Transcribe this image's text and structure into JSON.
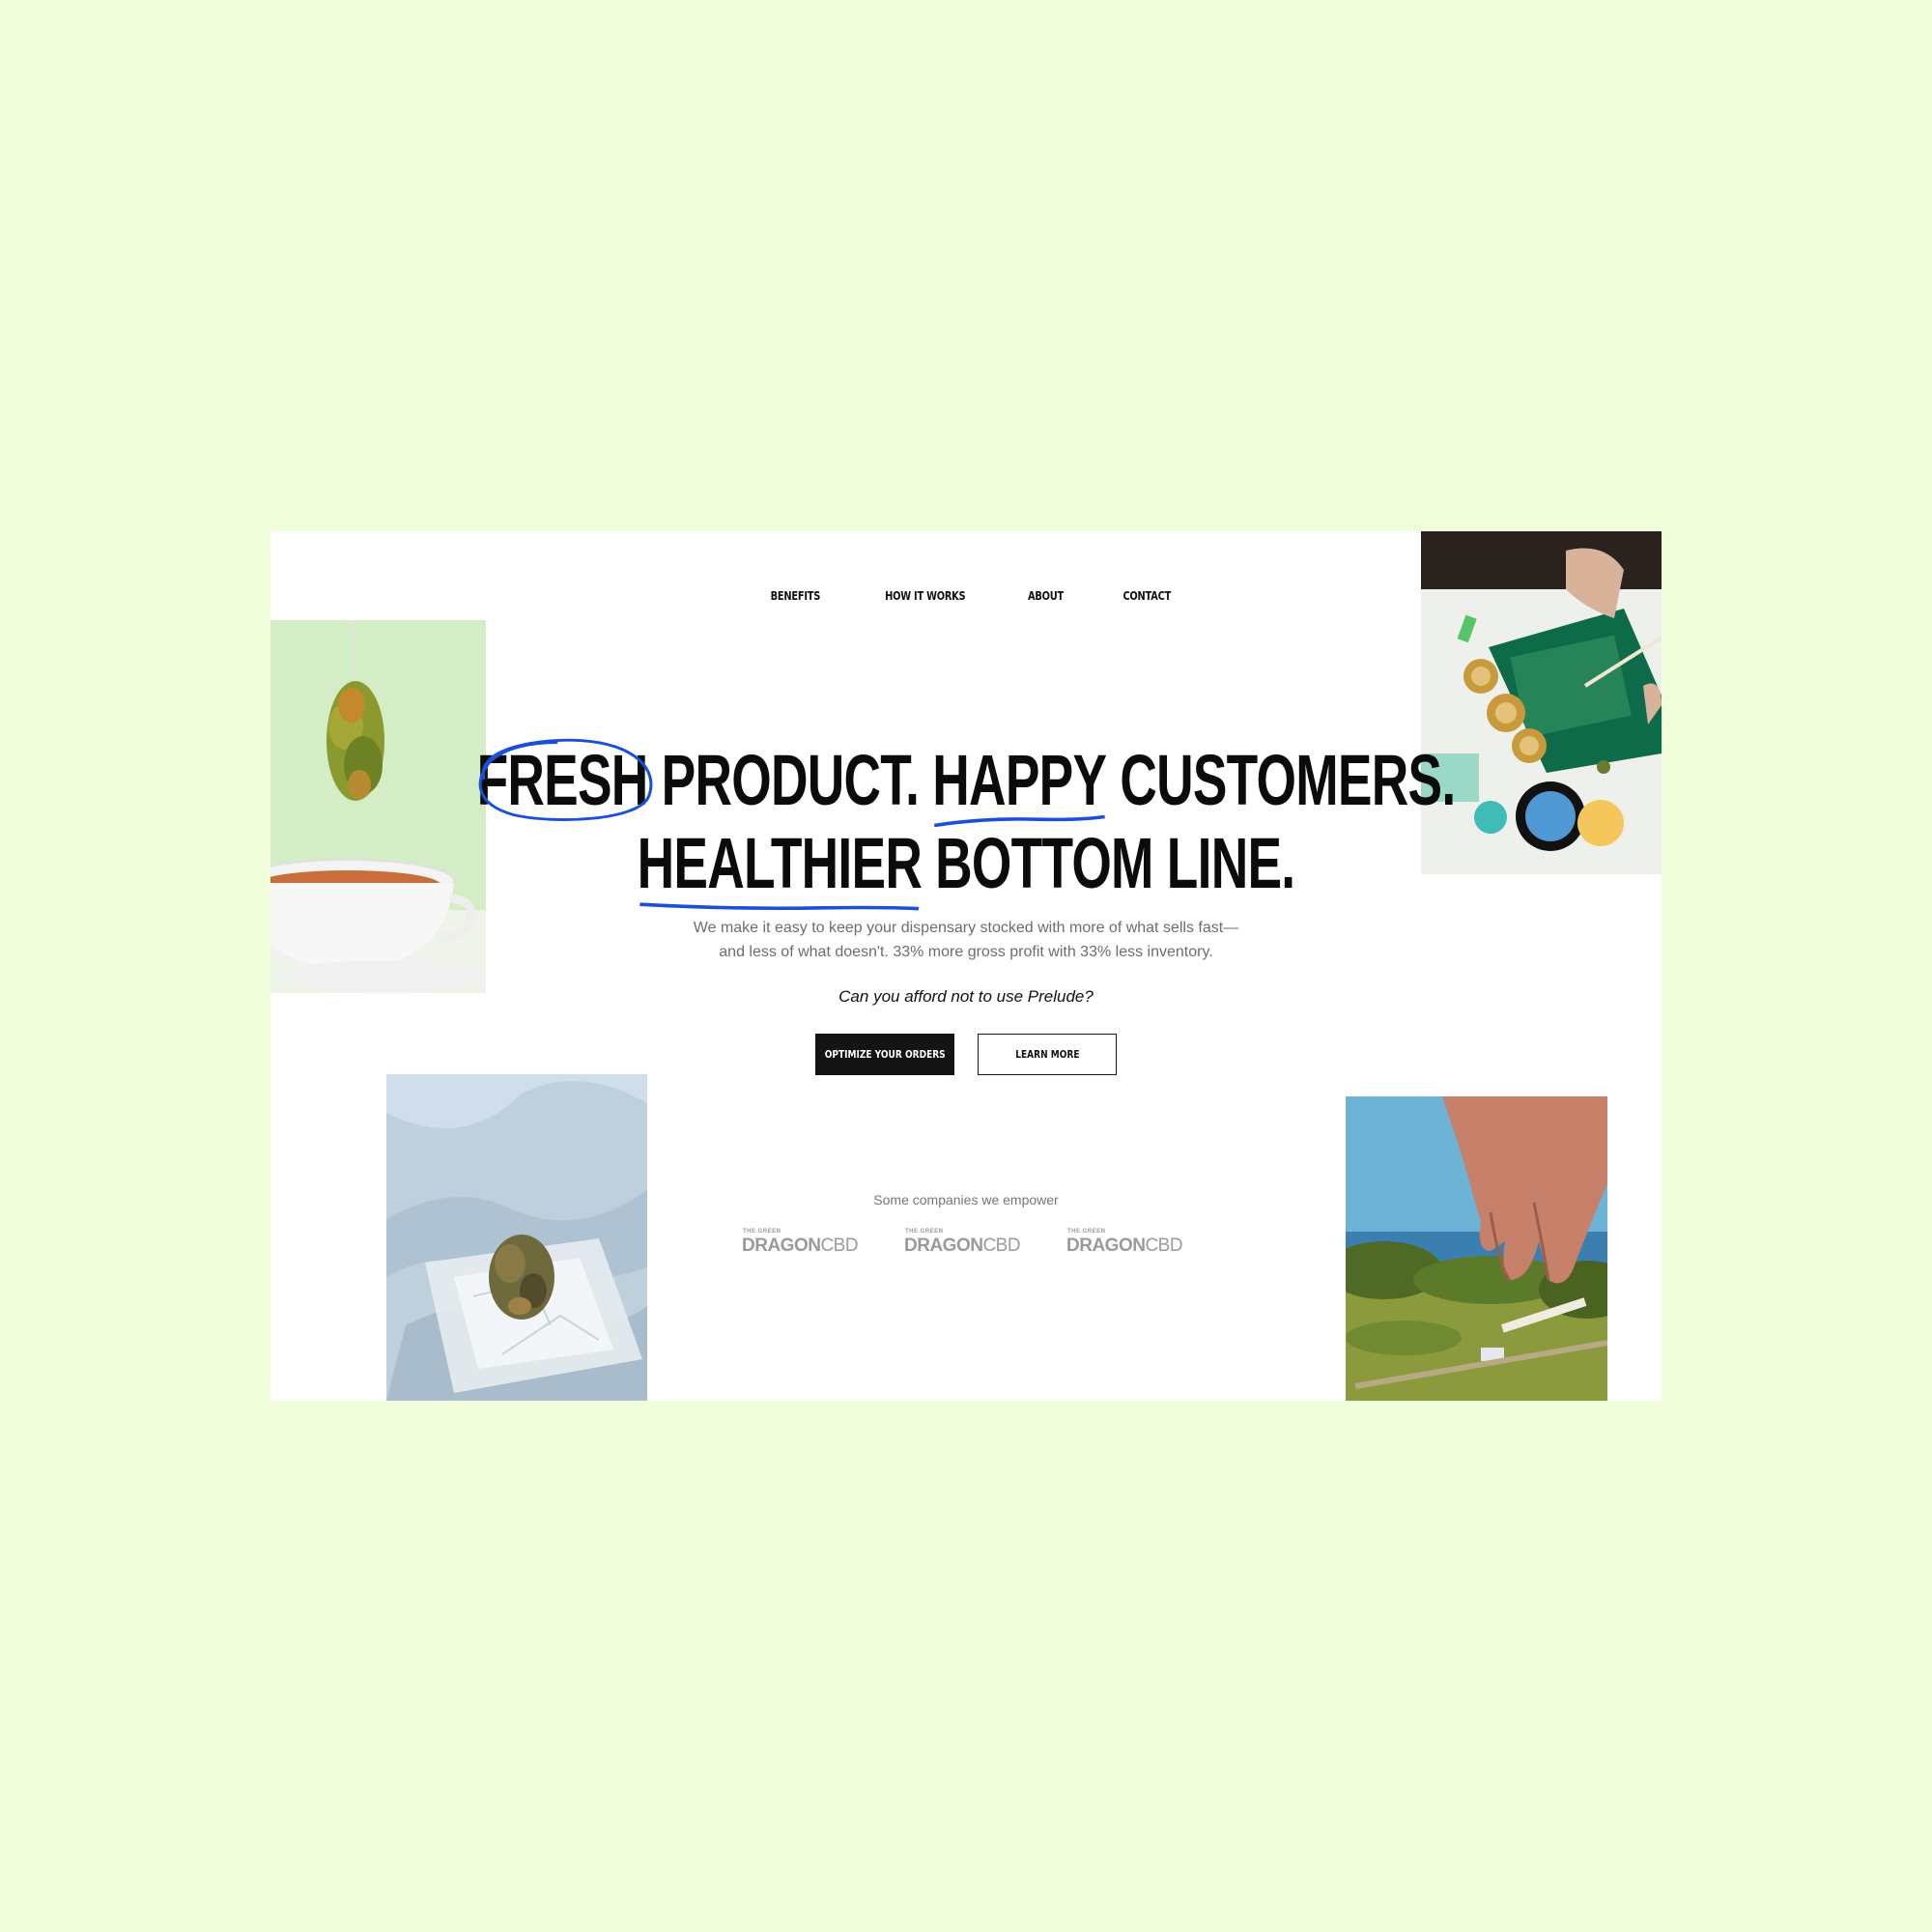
{
  "nav": {
    "items": [
      "BENEFITS",
      "HOW IT WORKS",
      "ABOUT",
      "CONTACT"
    ]
  },
  "hero": {
    "line1": {
      "w1": "FRESH",
      "w2": " PRODUCT. ",
      "w3": "HAPPY",
      "w4": " CUSTOMERS."
    },
    "line2": {
      "w1": "HEALTHIER",
      "w2": " BOTTOM LINE."
    },
    "subtitle_line1": "We make it easy to keep your dispensary stocked with more of what sells fast—",
    "subtitle_line2": "and less of what doesn't. 33% more gross profit with 33% less inventory.",
    "question": "Can you afford not to use Prelude?",
    "primary_button": "OPTIMIZE YOUR ORDERS",
    "secondary_button": "LEARN MORE"
  },
  "logos": {
    "caption": "Some companies we empower",
    "items": [
      {
        "small": "THE GREEN",
        "bold": "DRAGON",
        "light": "CBD"
      },
      {
        "small": "THE GREEN",
        "bold": "DRAGON",
        "light": "CBD"
      },
      {
        "small": "THE GREEN",
        "bold": "DRAGON",
        "light": "CBD"
      }
    ]
  },
  "colors": {
    "page_background": "#f1fedc",
    "annotation_blue": "#1a4fd8",
    "button_dark": "#141414"
  }
}
